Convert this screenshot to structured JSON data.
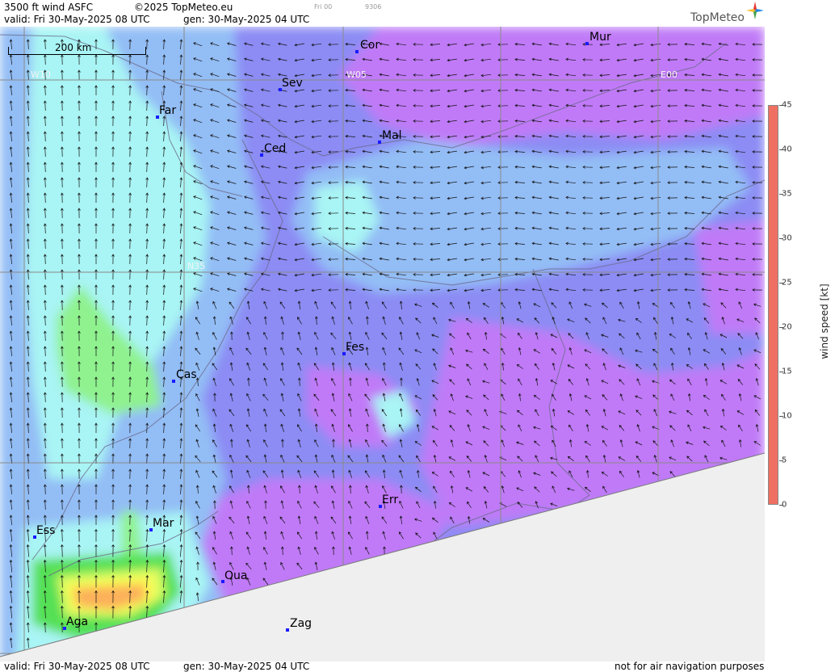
{
  "header": {
    "product": "3500 ft wind ASFC",
    "copyright": "©2025 TopMeteo.eu",
    "faint_code": "Fri 00",
    "faint_number": "9306",
    "valid": "valid:  Fri  30-May-2025  08 UTC",
    "generated": "gen: 30-May-2025 04 UTC"
  },
  "logo": {
    "text": "TopMeteo",
    "icon": "compass-star-icon"
  },
  "scale": {
    "label": "200 km"
  },
  "grid_labels": [
    "W10",
    "W05",
    "E00",
    "N35"
  ],
  "cities": [
    {
      "name": "Cor"
    },
    {
      "name": "Mur"
    },
    {
      "name": "Sev"
    },
    {
      "name": "Far"
    },
    {
      "name": "Ced"
    },
    {
      "name": "Mal"
    },
    {
      "name": "Fes"
    },
    {
      "name": "Cas"
    },
    {
      "name": "Err"
    },
    {
      "name": "Ess"
    },
    {
      "name": "Mar"
    },
    {
      "name": "Oua"
    },
    {
      "name": "Aga"
    },
    {
      "name": "Zag"
    }
  ],
  "legend": {
    "title": "wind speed [kt]",
    "ticks": [
      "0",
      "5",
      "10",
      "15",
      "20",
      "25",
      "30",
      "35",
      "40",
      "45"
    ],
    "colors": {
      "0": "#c07af7",
      "5": "#8c8cf4",
      "10": "#93bdf5",
      "15": "#a9f4f4",
      "20": "#8ff28f",
      "25": "#54e054",
      "30": "#dcfd64",
      "35": "#fdfd50",
      "40": "#fcb05a",
      "45": "#ef7062"
    }
  },
  "footer": {
    "valid": "valid:  Fri  30-May-2025  08 UTC",
    "generated": "gen: 30-May-2025 04 UTC",
    "disclaimer": "not for air navigation purposes"
  }
}
